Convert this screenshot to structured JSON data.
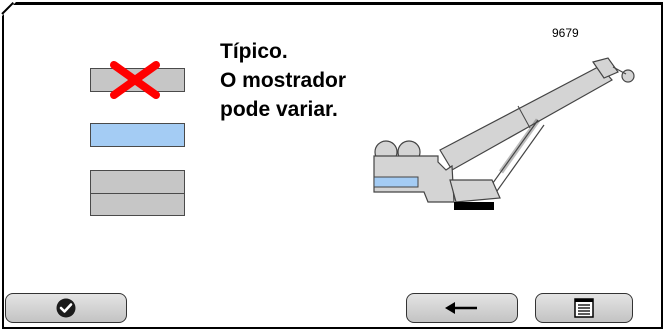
{
  "reference_number": "9679",
  "note_lines": [
    "Típico.",
    "O mostrador",
    "pode variar."
  ],
  "buttons": {
    "confirm_icon": "check-circle-icon",
    "back_icon": "arrow-left-icon",
    "menu_icon": "list-menu-icon"
  },
  "colors": {
    "cancel_mark": "#ff0000",
    "blue_bar": "#a4ccf4",
    "grey_bar": "#c6c6c6",
    "crane_fill": "#d4d4d4",
    "track": "#000000"
  }
}
